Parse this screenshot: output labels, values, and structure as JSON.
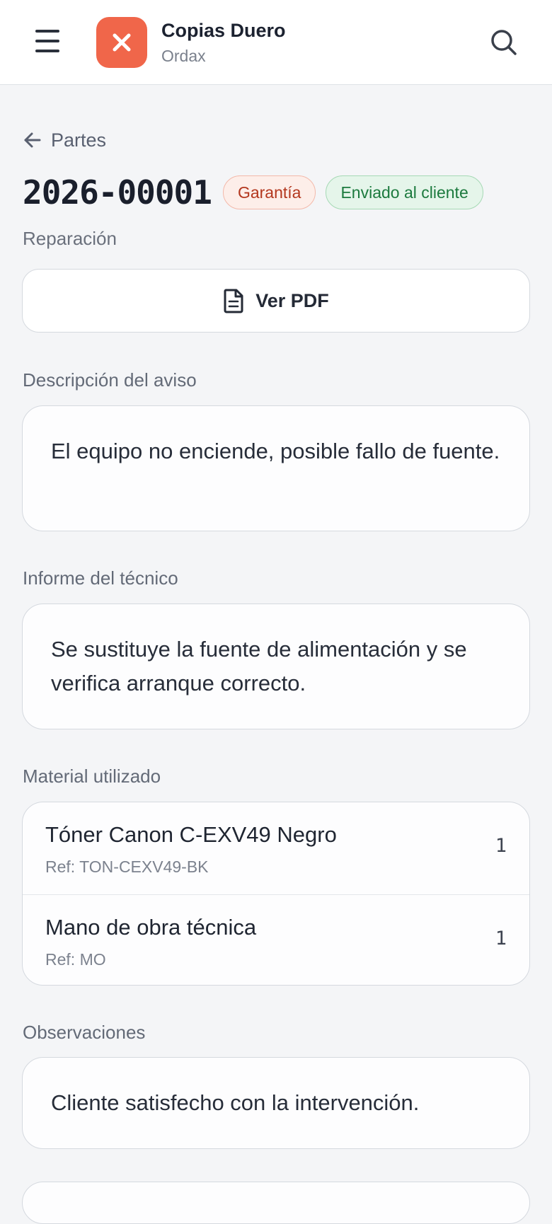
{
  "header": {
    "app_name": "Copias Duero",
    "app_subtitle": "Ordax",
    "icons": {
      "menu": "hamburger-menu-icon",
      "logo": "close-x-icon",
      "search": "search-icon"
    },
    "logo_color": "#f0664a"
  },
  "nav": {
    "back_label": "Partes",
    "back_icon": "arrow-left-icon"
  },
  "document": {
    "number": "2026-00001",
    "type": "Reparación",
    "badges": {
      "warranty": "Garantía",
      "status": "Enviado al cliente"
    },
    "badge_colors": {
      "warranty_text": "#b3371e",
      "warranty_bg": "#fdeee9",
      "status_text": "#1c7a3e",
      "status_bg": "#e5f5ea"
    }
  },
  "actions": {
    "view_pdf": "Ver PDF",
    "pdf_icon": "document-icon"
  },
  "sections": {
    "notice": {
      "label": "Descripción del aviso",
      "text": "El equipo no enciende, posible fallo de fuente."
    },
    "technician_report": {
      "label": "Informe del técnico",
      "text": "Se sustituye la fuente de alimentación y se verifica arranque correcto."
    },
    "materials": {
      "label": "Material utilizado",
      "items": [
        {
          "name": "Tóner Canon C-EXV49 Negro",
          "ref": "Ref: TON-CEXV49-BK",
          "qty": "1"
        },
        {
          "name": "Mano de obra técnica",
          "ref": "Ref: MO",
          "qty": "1"
        }
      ]
    },
    "observations": {
      "label": "Observaciones",
      "text": "Cliente satisfecho con la intervención."
    }
  }
}
